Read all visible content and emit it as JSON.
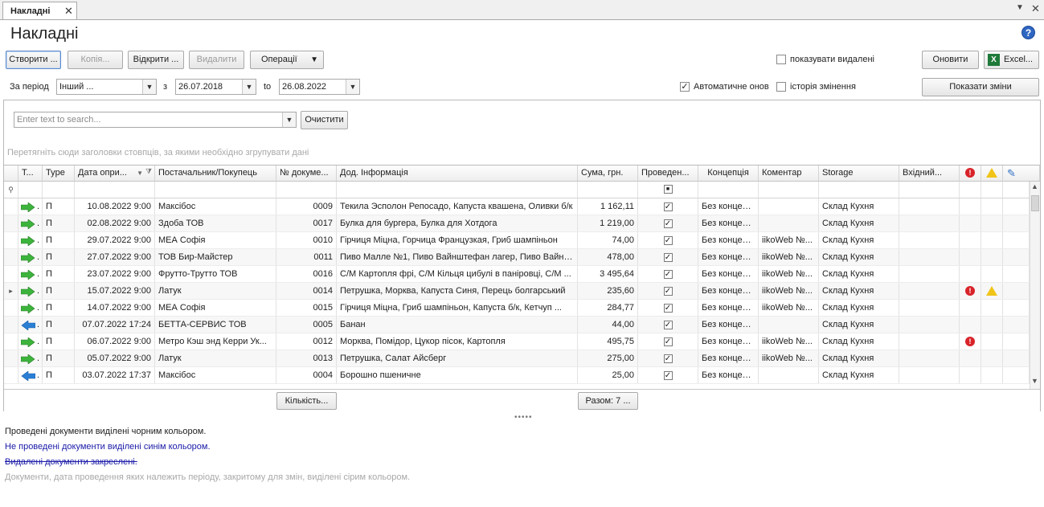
{
  "tab": {
    "label": "Накладні"
  },
  "page": {
    "title": "Накладні"
  },
  "toolbar": {
    "create": "Створити ...",
    "copy": "Копія...",
    "open": "Відкрити ...",
    "delete": "Видалити",
    "operations": "Операції",
    "show_deleted": "показувати видалені",
    "refresh": "Оновити",
    "excel": "Excel..."
  },
  "period": {
    "label": "За період",
    "value": "Інший ...",
    "from_sep": "з",
    "from": "26.07.2018",
    "to_sep": "to",
    "to": "26.08.2022",
    "auto_label": "Автоматичне онов",
    "history_label": "історія змінення",
    "show_changes": "Показати зміни"
  },
  "search": {
    "placeholder": "Enter text to search...",
    "clear": "Очистити"
  },
  "group_hint": "Перетягніть сюди заголовки стовпців, за якими необхідно згрупувати дані",
  "columns": {
    "t": "Т...",
    "type": "Type",
    "date": "Дата опри...",
    "supplier": "Постачальник/Покупець",
    "doc_no": "№ докуме...",
    "info": "Дод. Інформація",
    "sum": "Сума, грн.",
    "posted": "Проведен...",
    "concept": "Концепція",
    "comment": "Коментар",
    "storage": "Storage",
    "incoming": "Вхідний..."
  },
  "rows": [
    {
      "dir": "in",
      "type": "П",
      "date": "10.08.2022 9:00",
      "supplier": "Максібос",
      "doc_no": "0009",
      "info": "Текила Эсполон Репосадо, Капуста квашена, Оливки б/к",
      "sum": "1 162,11",
      "concept": "Без концепції",
      "comment": "",
      "storage": "Склад Кухня",
      "err": false,
      "warn": false
    },
    {
      "dir": "in",
      "type": "П",
      "date": "02.08.2022 9:00",
      "supplier": "Здоба ТОВ",
      "doc_no": "0017",
      "info": "Булка для бургера, Булка для Хотдога",
      "sum": "1 219,00",
      "concept": "Без концепції",
      "comment": "",
      "storage": "Склад Кухня",
      "err": false,
      "warn": false
    },
    {
      "dir": "in",
      "type": "П",
      "date": "29.07.2022 9:00",
      "supplier": "МЕА Софія",
      "doc_no": "0010",
      "info": "Гірчиця Міцна, Горчица Французкая, Гриб шампіньон",
      "sum": "74,00",
      "concept": "Без концепції",
      "comment": "iikoWeb №...",
      "storage": "Склад Кухня",
      "err": false,
      "warn": false
    },
    {
      "dir": "in",
      "type": "П",
      "date": "27.07.2022 9:00",
      "supplier": "ТОВ Бир-Майстер",
      "doc_no": "0011",
      "info": "Пиво Малле №1, Пиво Вайнштефан лагер, Пиво Вайнш...",
      "sum": "478,00",
      "concept": "Без концепції",
      "comment": "iikoWeb №...",
      "storage": "Склад Кухня",
      "err": false,
      "warn": false
    },
    {
      "dir": "in",
      "type": "П",
      "date": "23.07.2022 9:00",
      "supplier": "Фрутто-Трутто ТОВ",
      "doc_no": "0016",
      "info": "С/М Картопля фрі, С/М Кільця цибулі в паніровці, С/М ...",
      "sum": "3 495,64",
      "concept": "Без концепції",
      "comment": "iikoWeb №...",
      "storage": "Склад Кухня",
      "err": false,
      "warn": false
    },
    {
      "dir": "in",
      "type": "П",
      "date": "15.07.2022 9:00",
      "supplier": "Латук",
      "doc_no": "0014",
      "info": "Петрушка, Морква, Капуста Синя, Перець болгарський",
      "sum": "235,60",
      "concept": "Без концепції",
      "comment": "iikoWeb №...",
      "storage": "Склад Кухня",
      "err": true,
      "warn": true
    },
    {
      "dir": "in",
      "type": "П",
      "date": "14.07.2022 9:00",
      "supplier": "МЕА Софія",
      "doc_no": "0015",
      "info": "Гірчиця Міцна, Гриб шампіньон, Капуста б/к, Кетчуп ...",
      "sum": "284,77",
      "concept": "Без концепції",
      "comment": "iikoWeb №...",
      "storage": "Склад Кухня",
      "err": false,
      "warn": false
    },
    {
      "dir": "out",
      "type": "П",
      "date": "07.07.2022 17:24",
      "supplier": "БЕТТА-СЕРВИС ТОВ",
      "doc_no": "0005",
      "info": "Банан",
      "sum": "44,00",
      "concept": "Без концепції",
      "comment": "",
      "storage": "Склад Кухня",
      "err": false,
      "warn": false
    },
    {
      "dir": "in",
      "type": "П",
      "date": "06.07.2022 9:00",
      "supplier": "Метро Кэш энд Керри Ук...",
      "doc_no": "0012",
      "info": "Морква, Помідор, Цукор пісок, Картопля",
      "sum": "495,75",
      "concept": "Без концепції",
      "comment": "iikoWeb №...",
      "storage": "Склад Кухня",
      "err": true,
      "warn": false
    },
    {
      "dir": "in",
      "type": "П",
      "date": "05.07.2022 9:00",
      "supplier": "Латук",
      "doc_no": "0013",
      "info": "Петрушка, Салат Айсберг",
      "sum": "275,00",
      "concept": "Без концепції",
      "comment": "iikoWeb №...",
      "storage": "Склад Кухня",
      "err": false,
      "warn": false
    },
    {
      "dir": "out",
      "type": "П",
      "date": "03.07.2022 17:37",
      "supplier": "Максібос",
      "doc_no": "0004",
      "info": "Борошно пшеничне",
      "sum": "25,00",
      "concept": "Без концепції",
      "comment": "",
      "storage": "Склад Кухня",
      "err": false,
      "warn": false
    }
  ],
  "footer": {
    "count": "Кількість...",
    "total": "Разом: 7 ..."
  },
  "legend": {
    "posted": "Проведені документи виділені чорним кольором.",
    "not_posted": "Не проведені документи виділені синім кольором.",
    "deleted": "Видалені документи закреслені.",
    "closed": "Документи, дата проведення яких належить періоду, закритому для змін, виділені сірим кольором."
  },
  "colors": {
    "arrow_in": "#3cb43c",
    "arrow_out": "#2a7fd4",
    "error": "#d9232a",
    "warning": "#f0c419"
  }
}
